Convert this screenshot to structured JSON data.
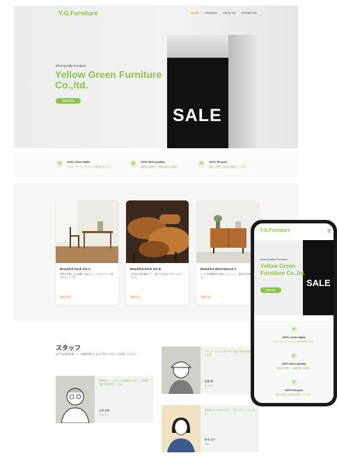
{
  "site": {
    "logo": "Y.G.Furniture",
    "nav": [
      "Home",
      "Products",
      "About Us",
      "Contact Us"
    ]
  },
  "hero": {
    "tagline": "Best Quality Furniture",
    "title": "Yellow Green Furniture Co.,ltd.",
    "button": "詳細を見る",
    "sale_text": "SALE"
  },
  "features": [
    {
      "icon": "hammer-icon",
      "title": "100% Order Made",
      "desc": "フルオーダーで、ぴったりの家具を作ります。"
    },
    {
      "icon": "badge-icon",
      "title": "100% Best Quality",
      "desc": "高品質な素材と、熟練の職人の技術。"
    },
    {
      "icon": "recycle-icon",
      "title": "100% Recycle",
      "desc": "環境に配慮した素材を使用しています。"
    }
  ],
  "products": [
    {
      "name": "Beautiful Desk Set A",
      "desc": "自然光が差し込む部屋に似合うシンプルなデスクと椅子のセットです。",
      "more": "詳細を見る"
    },
    {
      "name": "Beautiful Desk Set B",
      "desc": "上質な木材を使用した、温もりのあるデザインのチェアです。",
      "more": "詳細を見る"
    },
    {
      "name": "Beautiful Wood Board X",
      "desc": "レトロな雰囲気の木製キャビネット。収納力も抜群です。",
      "more": "詳細を見る"
    }
  ],
  "staff": {
    "title": "スタッフ",
    "intro": "私たちは家具を通じて、お客様の暮らしをより豊かにすることを目指しています。",
    "members": [
      {
        "bio": "家具職人として20年以上の経験があります。お客様の理想の家具を形にします。",
        "name": "山田 太郎",
        "role": "Craftsman"
      },
      {
        "bio": "デザイナーとして、使いやすく美しい家具を提案いたします。",
        "name": "佐藤 健",
        "role": "Designer"
      },
      {
        "bio": "素材選びからお手入れまで、丁寧にサポートいたします。",
        "name": "鈴木 花子",
        "role": "Staff"
      }
    ]
  },
  "mobile": {
    "logo": "Y.G.Furniture",
    "tagline": "Best Quality Furniture",
    "title": "Yellow Green Furniture Co.,ltd.",
    "button": "詳細を見る",
    "sale_text": "SALE",
    "features": [
      {
        "title": "100% Order Made",
        "desc": "フルオーダーで、ぴったりの家具を作ります。"
      },
      {
        "title": "100% Best Quality",
        "desc": "高品質な素材と、熟練の職人の技術。"
      },
      {
        "title": "100% Recycle",
        "desc": "環境に配慮した素材を使用しています。"
      }
    ]
  },
  "colors": {
    "accent": "#8bc34a",
    "nav_active": "#f08a24",
    "dark": "#111111"
  }
}
